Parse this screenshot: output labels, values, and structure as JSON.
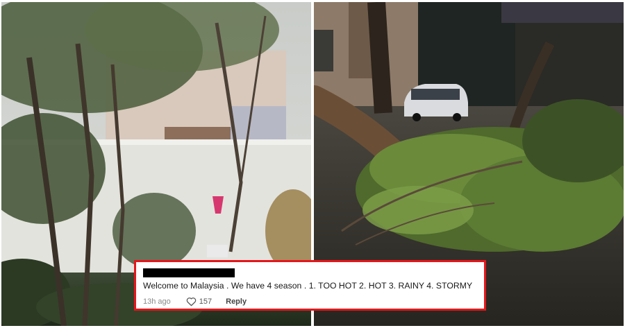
{
  "comment": {
    "author_redacted": true,
    "text": "Welcome to Malaysia . We have 4 season . 1. TOO HOT 2. HOT 3. RAINY 4. STORMY",
    "time": "13h ago",
    "likes": "157",
    "reply_label": "Reply"
  },
  "colors": {
    "highlight_border": "#e5161b",
    "redaction": "#000000"
  },
  "icons": {
    "like": "heart-outline-icon"
  }
}
